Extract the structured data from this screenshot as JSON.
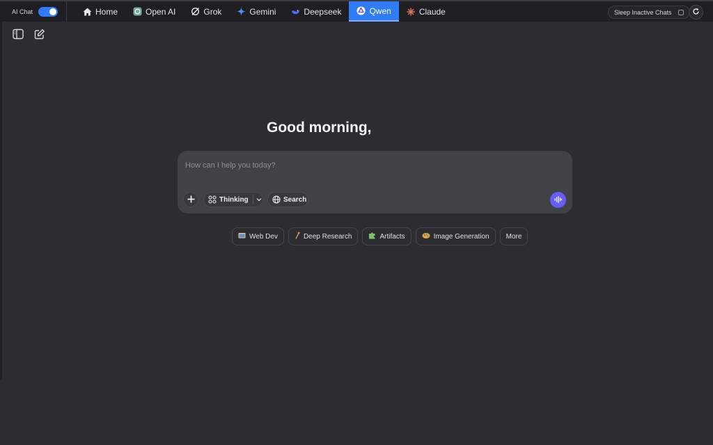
{
  "topbar": {
    "ai_chat_label": "AI Chat",
    "tabs": [
      {
        "label": "Home",
        "icon": "home-icon"
      },
      {
        "label": "Open AI",
        "icon": "openai-icon"
      },
      {
        "label": "Grok",
        "icon": "grok-icon"
      },
      {
        "label": "Gemini",
        "icon": "gemini-icon"
      },
      {
        "label": "Deepseek",
        "icon": "deepseek-icon"
      },
      {
        "label": "Qwen",
        "icon": "qwen-icon",
        "active": true
      },
      {
        "label": "Claude",
        "icon": "claude-icon"
      }
    ],
    "sleep_label": "Sleep Inactive Chats"
  },
  "main": {
    "greeting": "Good morning,",
    "input_placeholder": "How can I help you today?",
    "thinking_label": "Thinking",
    "search_label": "Search",
    "chips": [
      {
        "label": "Web Dev",
        "icon": "web-dev-icon"
      },
      {
        "label": "Deep Research",
        "icon": "deep-research-icon"
      },
      {
        "label": "Artifacts",
        "icon": "artifacts-icon"
      },
      {
        "label": "Image Generation",
        "icon": "image-generation-icon"
      },
      {
        "label": "More",
        "icon": ""
      }
    ]
  },
  "colors": {
    "accent": "#2f7cf6",
    "voice": "#6a5cf6",
    "background": "#2c2c31"
  }
}
